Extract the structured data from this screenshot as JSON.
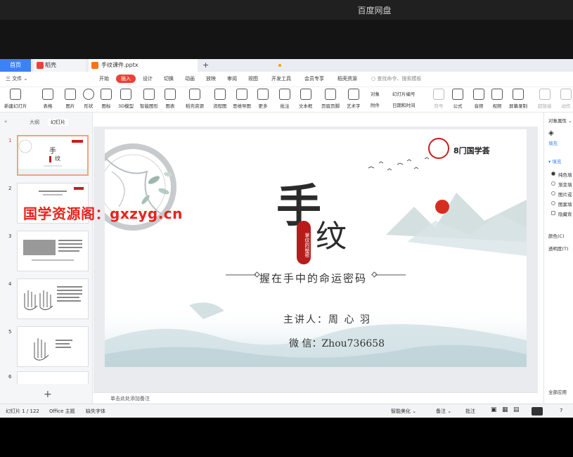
{
  "player": {
    "title": "百度网盘"
  },
  "tabs": {
    "home": "首页",
    "doc": "稻壳",
    "ppt": "手纹课件.pptx",
    "add": "+"
  },
  "menu": {
    "file": "三 文件 ⌄",
    "items": [
      "开始",
      "插入",
      "设计",
      "切换",
      "动画",
      "放映",
      "审阅",
      "视图",
      "开发工具",
      "会员专享",
      "稻壳资源"
    ],
    "search": "○ 查找命令、搜索模板"
  },
  "ribbon": {
    "new_slide": "新建幻灯片",
    "table": "表格",
    "picture": "图片",
    "shape": "形状",
    "icon": "图标",
    "model3d": "3D模型",
    "smart_graphic": "智能图形",
    "chart": "图表",
    "res": "稻壳资源",
    "flowchart": "流程图",
    "mindmap": "思维导图",
    "more": "更多",
    "comment": "批注",
    "textbox": "文本框",
    "header_footer": "页眉页脚",
    "wordart": "艺术字",
    "object": "对象",
    "slide_num": "幻灯片编号",
    "attach": "附件",
    "datetime": "日期和时间",
    "symbol": "符号",
    "formula": "公式",
    "audio": "音频",
    "video": "视频",
    "screen_record": "屏幕录制",
    "hyperlink": "超链接",
    "action": "动作"
  },
  "left_panel": {
    "tab_outline": "大纲",
    "tab_slides": "幻灯片",
    "slide_numbers": [
      "1",
      "2",
      "3",
      "4",
      "5",
      "6"
    ],
    "add": "+"
  },
  "watermark": "国学资源阁：gxzyg.cn",
  "slide": {
    "brand": "8门国学荟",
    "title_char1": "手",
    "title_char2": "纹",
    "seal_text": "掌纹的秘密",
    "subtitle": "握在手中的命运密码",
    "speaker": "主讲人：周  心  羽",
    "wechat": "微  信：Zhou736658"
  },
  "notes": "单击此处添加备注",
  "right_panel": {
    "title": "对象属性 ⌄",
    "tab": "填充",
    "section": "▾ 填充",
    "options": [
      "纯色填",
      "渐变填",
      "图片或",
      "图案填",
      "隐藏背"
    ],
    "color": "颜色(C)",
    "transparency": "透明度(T)",
    "apply_all": "全部应用"
  },
  "status": {
    "slide_pos": "幻灯片 1 / 122",
    "theme": "Office 主题",
    "font_missing": "缺失字体",
    "beautify": "智能美化 ⌄",
    "notes": "备注 ⌄",
    "comments": "批注",
    "zoom": "7"
  }
}
